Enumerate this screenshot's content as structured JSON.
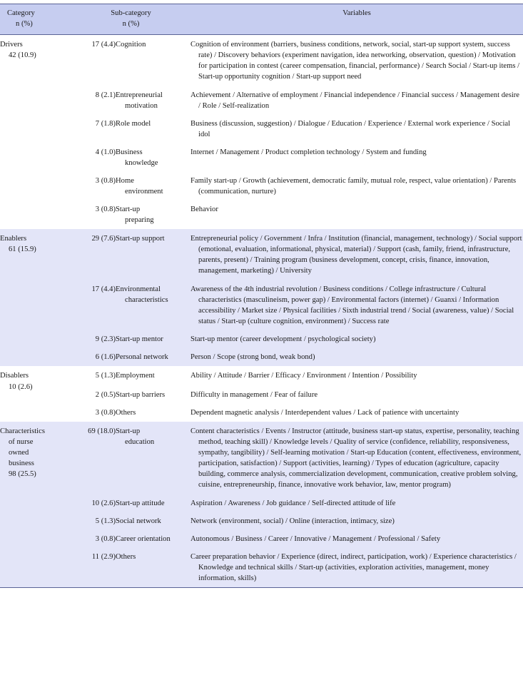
{
  "top_sliver_text": " ",
  "colors": {
    "header_band": "#c6cdf0",
    "shaded_band": "#e3e5f8",
    "plain_band": "#ffffff",
    "rule": "#5a6396",
    "text": "#1a1a1a"
  },
  "header": {
    "category_line1": "Category",
    "category_line2": "n (%)",
    "subcategory_line1": "Sub-category",
    "subcategory_line2": "n (%)",
    "variables": "Variables"
  },
  "groups": [
    {
      "id": "drivers",
      "shaded": false,
      "category_line1": "Drivers",
      "category_line2": "42 (10.9)",
      "rows": [
        {
          "n": "17 (4.4)",
          "sub_line1": "Cognition",
          "sub_line2": "",
          "variables": "Cognition of environment (barriers, business conditions, network, social, start-up support system, success rate) / Discovery behaviors (experiment navigation, idea networking, observation, question) / Motivation for participation in contest (career compensation, financial, performance) / Search Social / Start-up items / Start-up opportunity cognition / Start-up support need"
        },
        {
          "n": "8 (2.1)",
          "sub_line1": "Entrepreneurial",
          "sub_line2": "motivation",
          "variables": "Achievement / Alternative of employment / Financial independence / Financial success / Management desire / Role / Self-realization"
        },
        {
          "n": "7 (1.8)",
          "sub_line1": "Role model",
          "sub_line2": "",
          "variables": "Business (discussion, suggestion) / Dialogue / Education / Experience / External work experience / Social idol"
        },
        {
          "n": "4 (1.0)",
          "sub_line1": "Business",
          "sub_line2": "knowledge",
          "variables": "Internet / Management / Product completion technology / System and funding"
        },
        {
          "n": "3 (0.8)",
          "sub_line1": "Home",
          "sub_line2": "environment",
          "variables": "Family start-up / Growth (achievement, democratic family, mutual role, respect, value orientation) / Parents (communication, nurture)"
        },
        {
          "n": "3 (0.8)",
          "sub_line1": "Start-up",
          "sub_line2": "preparing",
          "variables": "Behavior"
        }
      ]
    },
    {
      "id": "enablers",
      "shaded": true,
      "category_line1": "Enablers",
      "category_line2": "61 (15.9)",
      "rows": [
        {
          "n": "29 (7.6)",
          "sub_line1": "Start-up support",
          "sub_line2": "",
          "variables": "Entrepreneurial policy / Government / Infra / Institution (financial, management, technology) / Social support (emotional, evaluation, informational, physical, material) / Support (cash, family, friend, infrastructure, parents, present) / Training program (business development, concept, crisis, finance, innovation, management, marketing) / University"
        },
        {
          "n": "17 (4.4)",
          "sub_line1": "Environmental",
          "sub_line2": "characteristics",
          "variables": "Awareness of the 4th industrial revolution / Business conditions / College infrastructure / Cultural characteristics (masculineism, power gap) / Environmental factors (internet) / Guanxi / Information accessibility / Market size / Physical facilities / Sixth industrial trend / Social (awareness, value) / Social status / Start-up (culture cognition, environment) / Success rate"
        },
        {
          "n": "9 (2.3)",
          "sub_line1": "Start-up mentor",
          "sub_line2": "",
          "variables": "Start-up mentor (career development / psychological society)"
        },
        {
          "n": "6 (1.6)",
          "sub_line1": "Personal network",
          "sub_line2": "",
          "variables": "Person / Scope (strong bond, weak bond)"
        }
      ]
    },
    {
      "id": "disablers",
      "shaded": false,
      "category_line1": "Disablers",
      "category_line2": "10 (2.6)",
      "rows": [
        {
          "n": "5 (1.3)",
          "sub_line1": "Employment",
          "sub_line2": "",
          "variables": "Ability / Attitude / Barrier / Efficacy / Environment / Intention / Possibility"
        },
        {
          "n": "2 (0.5)",
          "sub_line1": "Start-up barriers",
          "sub_line2": "",
          "variables": "Difficulty in management / Fear of failure"
        },
        {
          "n": "3 (0.8)",
          "sub_line1": "Others",
          "sub_line2": "",
          "variables": "Dependent magnetic analysis / Interdependent values / Lack of patience with uncertainty"
        }
      ]
    },
    {
      "id": "characteristics",
      "shaded": true,
      "category_line1": "Characteristics",
      "category_line2": "of nurse",
      "category_line3": "owned",
      "category_line4": "business",
      "category_line5": "98 (25.5)",
      "rows": [
        {
          "n": "69 (18.0)",
          "sub_line1": "Start-up",
          "sub_line2": "education",
          "variables": "Content characteristics / Events / Instructor (attitude, business start-up status, expertise, personality, teaching method, teaching skill) / Knowledge levels / Quality of service (confidence, reliability, responsiveness, sympathy, tangibility) / Self-learning motivation / Start-up Education (content, effectiveness, environment, participation, satisfaction) / Support (activities, learning) / Types of education (agriculture, capacity building, commerce analysis, commercialization development, communication, creative problem solving, cuisine, entrepreneurship, finance, innovative work behavior, law, mentor program)"
        },
        {
          "n": "10 (2.6)",
          "sub_line1": "Start-up attitude",
          "sub_line2": "",
          "variables": "Aspiration / Awareness / Job guidance / Self-directed attitude of life"
        },
        {
          "n": "5 (1.3)",
          "sub_line1": "Social network",
          "sub_line2": "",
          "variables": "Network (environment, social) / Online (interaction, intimacy, size)"
        },
        {
          "n": "3 (0.8)",
          "sub_line1": "Career orientation",
          "sub_line2": "",
          "variables": "Autonomous / Business / Career / Innovative / Management / Professional / Safety"
        },
        {
          "n": "11 (2.9)",
          "sub_line1": "Others",
          "sub_line2": "",
          "variables": "Career preparation behavior / Experience (direct, indirect, participation, work) / Experience characteristics / Knowledge and technical skills / Start-up (activities, exploration activities, management, money information, skills)"
        }
      ]
    }
  ]
}
